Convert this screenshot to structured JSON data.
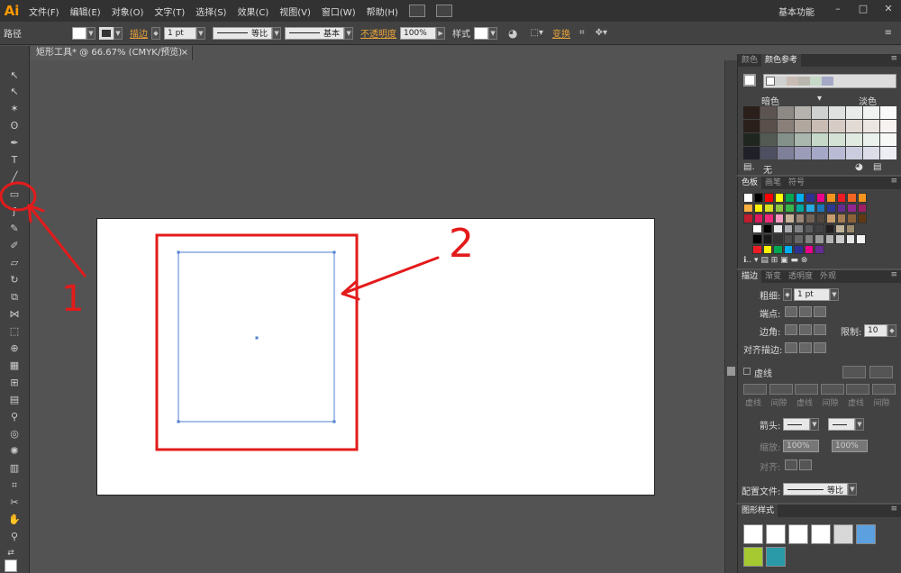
{
  "app": {
    "logo": "Ai",
    "workspace": "基本功能"
  },
  "menu": [
    "文件(F)",
    "编辑(E)",
    "对象(O)",
    "文字(T)",
    "选择(S)",
    "效果(C)",
    "视图(V)",
    "窗口(W)",
    "帮助(H)"
  ],
  "window_controls": {
    "minimize": "–",
    "maximize": "□",
    "close": "✕"
  },
  "control_bar": {
    "object_label": "路径",
    "stroke_label": "描边",
    "stroke_weight": "1 pt",
    "profile_label": "等比",
    "brush_label": "基本",
    "opacity_label": "不透明度",
    "opacity_value": "100%",
    "style_label": "样式",
    "transform_label": "变换"
  },
  "document_tab": {
    "title": "矩形工具* @ 66.67% (CMYK/预览)",
    "close": "×"
  },
  "color_panel": {
    "tabs": [
      "颜色",
      "颜色参考"
    ],
    "dark_label": "暗色",
    "light_label": "淡色",
    "none_label": "无",
    "base_colors": [
      "#cfd0d0",
      "#c9bcb4",
      "#b8b6af",
      "#c6d8c8",
      "#a6a8c8"
    ]
  },
  "swatches_panel": {
    "tabs": [
      "色板",
      "画笔",
      "符号"
    ]
  },
  "stroke_panel": {
    "tabs": [
      "描边",
      "渐变",
      "透明度",
      "外观"
    ],
    "weight_label": "粗细:",
    "weight_value": "1 pt",
    "cap_label": "端点:",
    "corner_label": "边角:",
    "limit_label": "限制:",
    "limit_value": "10",
    "align_label": "对齐描边:",
    "dashed_label": "虚线",
    "dash_labels": [
      "虚线",
      "间隙",
      "虚线",
      "间隙",
      "虚线",
      "间隙"
    ],
    "arrow_label": "箭头:",
    "scale_label": "缩放:",
    "scale_value_1": "100%",
    "scale_value_2": "100%",
    "align2_label": "对齐:",
    "profile_label": "配置文件:",
    "profile_value": "等比"
  },
  "graphic_styles_panel": {
    "tabs": [
      "图形样式"
    ]
  },
  "annotations": {
    "label_1": "1",
    "label_2": "2"
  },
  "colors": {
    "accent": "#ff9a00",
    "annotation": "#e31b1b",
    "selection": "#4f7fd0"
  }
}
